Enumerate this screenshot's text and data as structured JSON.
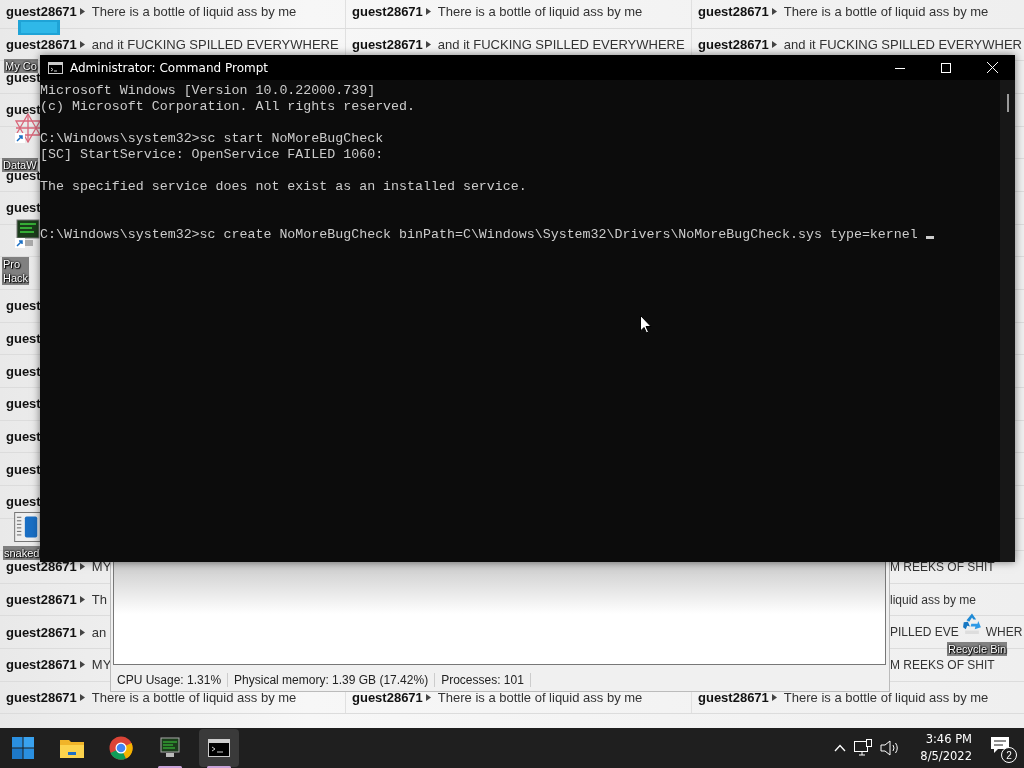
{
  "desktop": {
    "rows": [
      {
        "kind": "messages",
        "cells": [
          {
            "kind": "message",
            "user": "guest28671",
            "text": "There is a bottle of liquid ass by me"
          },
          {
            "kind": "message",
            "user": "guest28671",
            "text": "There is a bottle of liquid ass by me"
          },
          {
            "kind": "message",
            "user": "guest28671",
            "text": "There is a bottle of liquid ass by me"
          }
        ]
      },
      {
        "kind": "messages",
        "cells": [
          {
            "kind": "message",
            "user": "guest28671",
            "text": "and it FUCKING SPILLED EVERYWHERE"
          },
          {
            "kind": "message",
            "user": "guest28671",
            "text": "and it FUCKING SPILLED EVERYWHERE"
          },
          {
            "kind": "message",
            "user": "guest28671",
            "text": "and it FUCKING SPILLED EVERYWHER"
          }
        ]
      },
      {
        "kind": "messages",
        "cells": [
          {
            "kind": "user",
            "user": "guest"
          }
        ]
      },
      {
        "kind": "messages",
        "cells": [
          {
            "kind": "user",
            "user": "guest"
          }
        ]
      },
      {
        "kind": "covered"
      },
      {
        "kind": "messages",
        "cells": [
          {
            "kind": "user",
            "user": "guest"
          }
        ]
      },
      {
        "kind": "messages",
        "cells": [
          {
            "kind": "user",
            "user": "guest"
          }
        ]
      },
      {
        "kind": "covered"
      },
      {
        "kind": "covered"
      },
      {
        "kind": "messages",
        "cells": [
          {
            "kind": "user",
            "user": "guest"
          }
        ]
      },
      {
        "kind": "messages",
        "cells": [
          {
            "kind": "user",
            "user": "guest"
          }
        ]
      },
      {
        "kind": "messages",
        "cells": [
          {
            "kind": "user",
            "user": "guest"
          }
        ]
      },
      {
        "kind": "messages",
        "cells": [
          {
            "kind": "user",
            "user": "guest"
          }
        ]
      },
      {
        "kind": "messages",
        "cells": [
          {
            "kind": "user",
            "user": "guest"
          }
        ]
      },
      {
        "kind": "messages",
        "cells": [
          {
            "kind": "user",
            "user": "guest"
          }
        ]
      },
      {
        "kind": "messages",
        "cells": [
          {
            "kind": "user",
            "user": "guest"
          }
        ]
      },
      {
        "kind": "covered"
      },
      {
        "kind": "messages",
        "cells": [
          {
            "kind": "message",
            "user": "guest28671",
            "text": "MY"
          },
          {
            "kind": "tail",
            "text": "M REEKS OF SHIT"
          }
        ]
      },
      {
        "kind": "messages",
        "cells": [
          {
            "kind": "message",
            "user": "guest28671",
            "text": "Th"
          },
          {
            "kind": "tail",
            "text": "liquid ass by me"
          }
        ]
      },
      {
        "kind": "messages",
        "cells": [
          {
            "kind": "message",
            "user": "guest28671",
            "text": "an"
          },
          {
            "kind": "tail",
            "parts": [
              "PILLED EVE",
              "WHER"
            ]
          }
        ]
      },
      {
        "kind": "messages",
        "cells": [
          {
            "kind": "message",
            "user": "guest28671",
            "text": "MY"
          },
          {
            "kind": "tail",
            "text": "M REEKS OF SHIT"
          }
        ]
      },
      {
        "kind": "messages",
        "cells": [
          {
            "kind": "message",
            "user": "guest28671",
            "text": "There is a bottle of liquid ass by me"
          },
          {
            "kind": "message",
            "user": "guest28671",
            "text": "There is a bottle of liquid ass by me"
          },
          {
            "kind": "message",
            "user": "guest28671",
            "text": "There is a bottle of liquid ass by me"
          }
        ]
      }
    ],
    "icons": [
      {
        "kind": "monitor",
        "label": [
          "My Co"
        ],
        "shortcut": false
      },
      {
        "kind": "star",
        "label": [
          "DataW"
        ],
        "shortcut": true
      },
      {
        "kind": "computer",
        "label": [
          "Pro",
          "Hack"
        ],
        "shortcut": true
      },
      {
        "kind": "chart",
        "label": [
          "snaked"
        ],
        "shortcut": false
      },
      {
        "kind": "recycle",
        "label": [
          "Recycle Bin"
        ],
        "shortcut": false
      }
    ]
  },
  "task_manager": {
    "status": [
      "CPU Usage: 1.31%",
      "Physical memory: 1.39 GB (17.42%)",
      "Processes: 101"
    ]
  },
  "command_prompt": {
    "title": "Administrator: Command Prompt",
    "lines": [
      {
        "kind": "text",
        "text": "Microsoft Windows [Version 10.0.22000.739]"
      },
      {
        "kind": "text",
        "text": "(c) Microsoft Corporation. All rights reserved."
      },
      {
        "kind": "blank"
      },
      {
        "kind": "text",
        "text": "C:\\Windows\\system32>sc start NoMoreBugCheck"
      },
      {
        "kind": "text",
        "text": "[SC] StartService: OpenService FAILED 1060:"
      },
      {
        "kind": "blank"
      },
      {
        "kind": "text",
        "text": "The specified service does not exist as an installed service."
      },
      {
        "kind": "blank"
      },
      {
        "kind": "blank"
      },
      {
        "kind": "input",
        "text": "C:\\Windows\\system32>sc create NoMoreBugCheck binPath=C\\Windows\\System32\\Drivers\\NoMoreBugCheck.sys type=kernel"
      }
    ]
  },
  "taskbar": {
    "items": [
      {
        "kind": "start",
        "selected": false,
        "running": false
      },
      {
        "kind": "folder",
        "selected": false,
        "running": false
      },
      {
        "kind": "browser",
        "selected": false,
        "running": false
      },
      {
        "kind": "monitor",
        "selected": false,
        "running": true
      },
      {
        "kind": "terminal",
        "selected": true,
        "running": true
      }
    ],
    "time": "3:46 PM",
    "date": "8/5/2022",
    "notifications": "2"
  }
}
